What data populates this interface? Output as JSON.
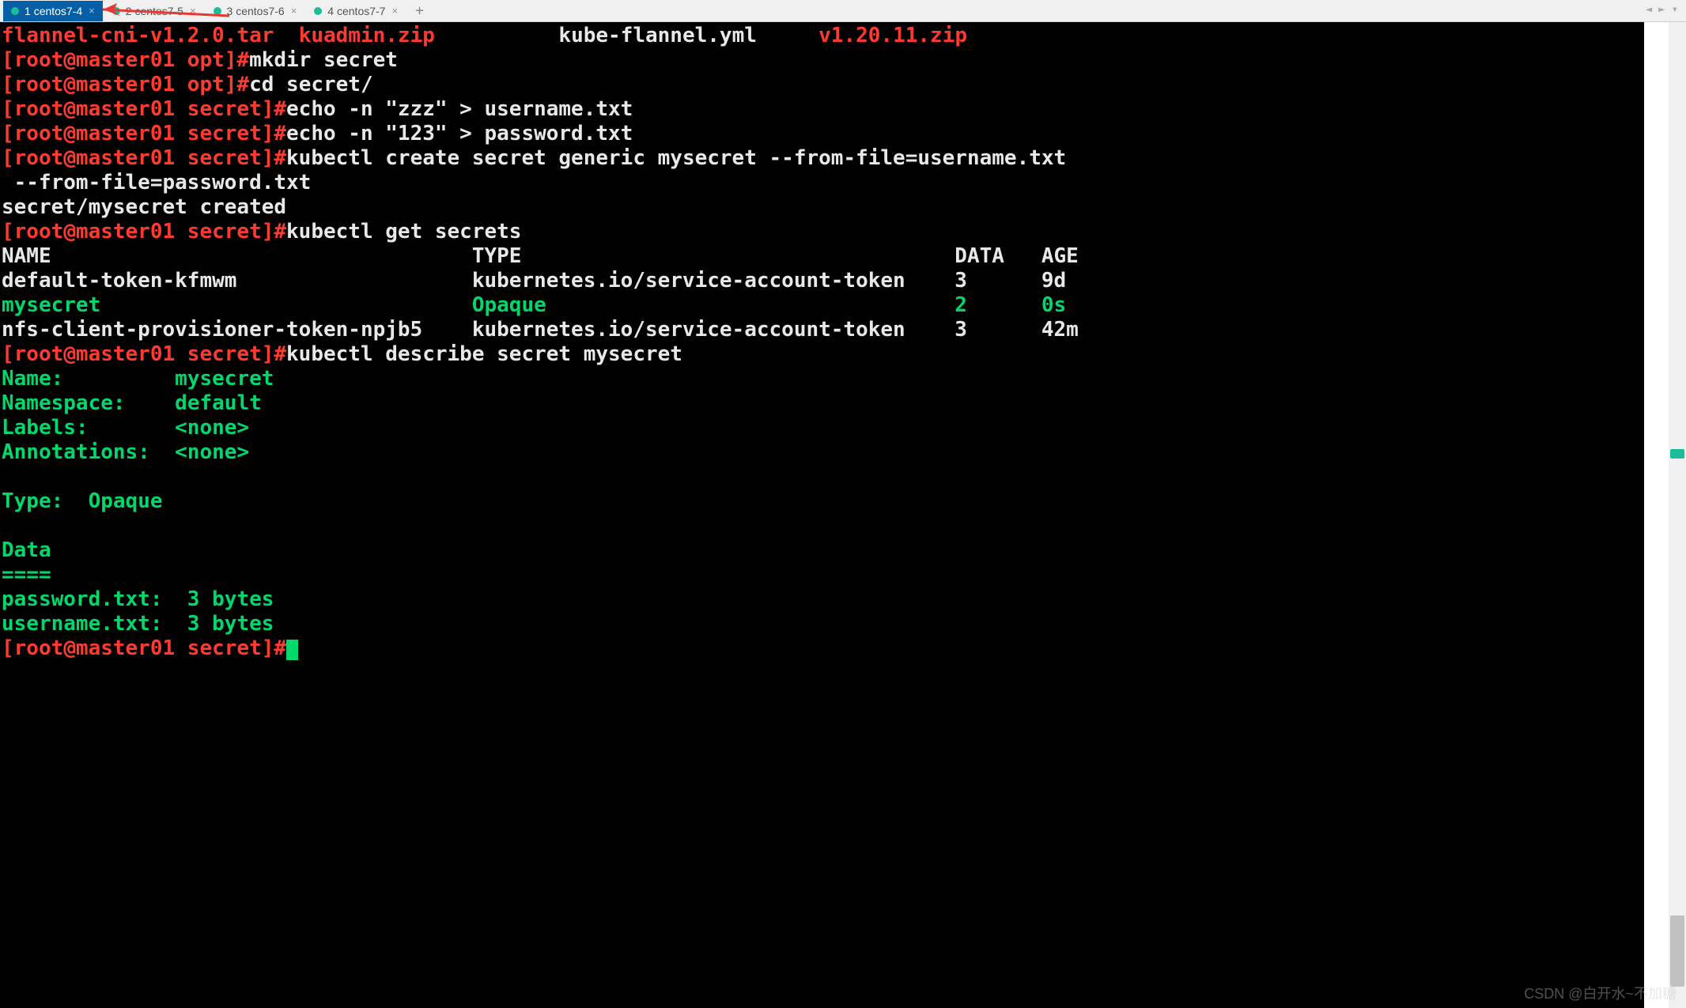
{
  "tabs": [
    {
      "index": "1",
      "label": "centos7-4",
      "active": true
    },
    {
      "index": "2",
      "label": "centos7-5",
      "active": false
    },
    {
      "index": "3",
      "label": "centos7-6",
      "active": false
    },
    {
      "index": "4",
      "label": "centos7-7",
      "active": false
    }
  ],
  "tab_add": "+",
  "tab_nav": {
    "prev": "◄",
    "next": "►",
    "menu": "▾"
  },
  "ls_files": {
    "f1": "flannel-cni-v1.2.0.tar",
    "f2": "kuadmin.zip",
    "f3": "kube-flannel.yml",
    "f4": "v1.20.11.zip"
  },
  "prompts": {
    "opt": "[root@master01 opt]#",
    "secret": "[root@master01 secret]#"
  },
  "cmds": {
    "mkdir": "mkdir secret",
    "cd": "cd secret/",
    "echo1": "echo -n \"zzz\" > username.txt",
    "echo2": "echo -n \"123\" > password.txt",
    "create": "kubectl create secret generic mysecret --from-file=username.txt",
    "create2": " --from-file=password.txt",
    "created_msg": "secret/mysecret created",
    "get": "kubectl get secrets",
    "describe": "kubectl describe secret mysecret"
  },
  "table": {
    "headers": {
      "name": "NAME",
      "type": "TYPE",
      "data": "DATA",
      "age": "AGE"
    },
    "rows": [
      {
        "name": "default-token-kfmwm",
        "type": "kubernetes.io/service-account-token",
        "data": "3",
        "age": "9d",
        "hl": false
      },
      {
        "name": "mysecret",
        "type": "Opaque",
        "data": "2",
        "age": "0s",
        "hl": true
      },
      {
        "name": "nfs-client-provisioner-token-npjb5",
        "type": "kubernetes.io/service-account-token",
        "data": "3",
        "age": "42m",
        "hl": false
      }
    ]
  },
  "describe": {
    "name_k": "Name:",
    "name_v": "mysecret",
    "ns_k": "Namespace:",
    "ns_v": "default",
    "labels_k": "Labels:",
    "labels_v": "<none>",
    "anno_k": "Annotations:",
    "anno_v": "<none>",
    "type_k": "Type:",
    "type_v": "Opaque",
    "data_hdr": "Data",
    "data_sep": "====",
    "pw": "password.txt:  3 bytes",
    "un": "username.txt:  3 bytes"
  },
  "watermark": "CSDN @白开水~不加糖"
}
